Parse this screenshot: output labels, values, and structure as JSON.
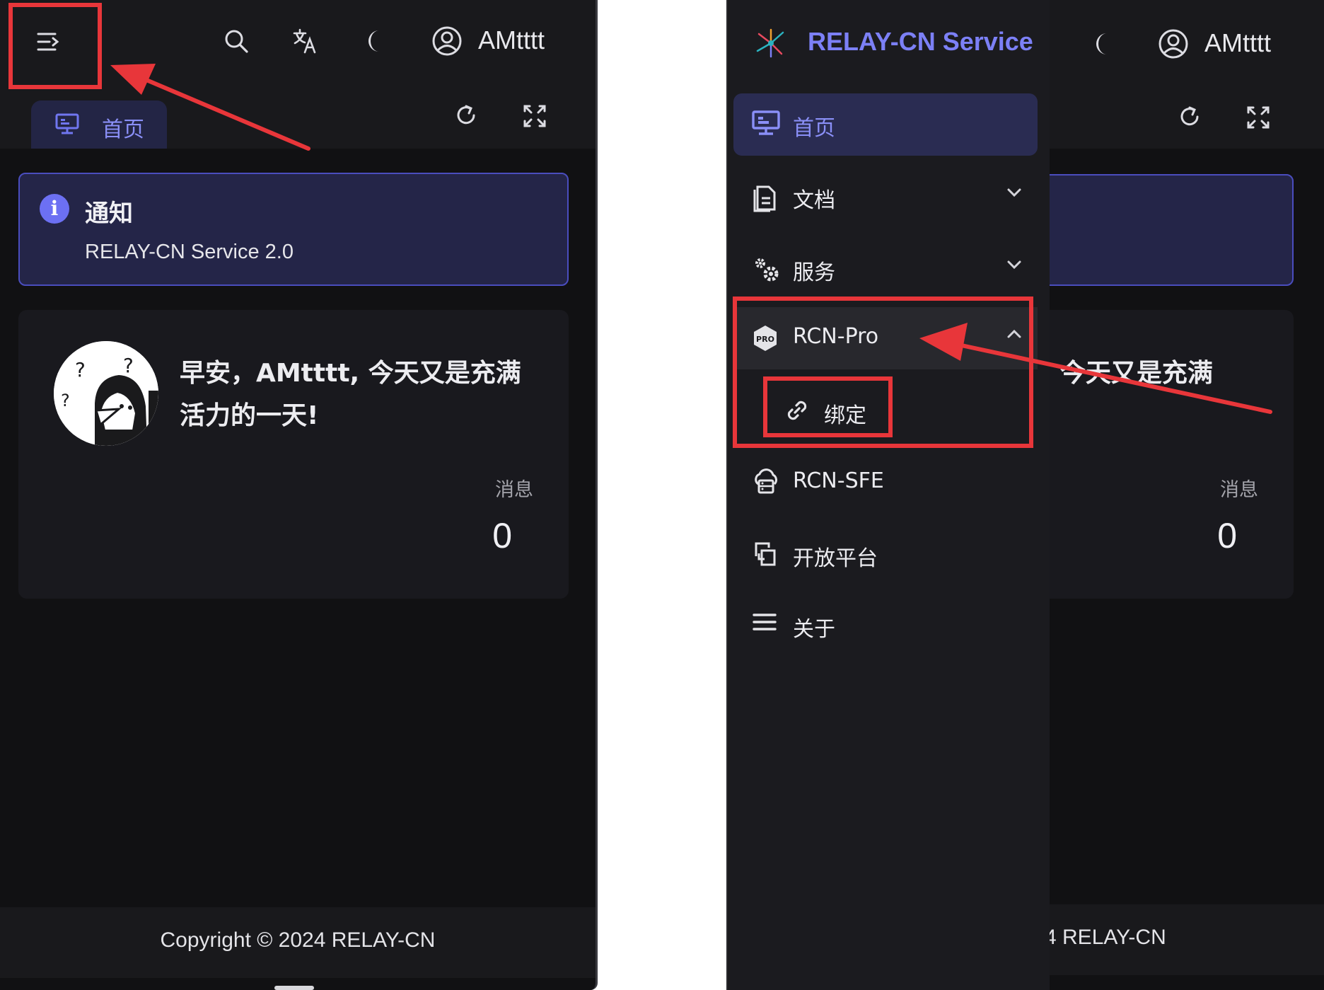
{
  "user": {
    "name": "AMtttt"
  },
  "tabs": {
    "home_label": "首页"
  },
  "notice": {
    "title": "通知",
    "message": "RELAY-CN Service 2.0",
    "icon": "info-icon",
    "accent": "#6c70f3"
  },
  "welcome": {
    "greeting_line1": "早安，AMtttt, 今天又是充满",
    "greeting_line2": "活力的一天!",
    "greeting_partial": "ttt, 今天又是充满",
    "messages_label": "消息",
    "messages_count": "0"
  },
  "footer": {
    "copyright": "Copyright © 2024 RELAY-CN",
    "copyright_partial": "4 RELAY-CN"
  },
  "sidebar": {
    "brand": "RELAY-CN Service",
    "items": [
      {
        "label": "首页",
        "icon": "monitor-icon",
        "active": true
      },
      {
        "label": "文档",
        "icon": "document-icon",
        "expandable": true
      },
      {
        "label": "服务",
        "icon": "gears-icon",
        "expandable": true
      },
      {
        "label": "RCN-Pro",
        "icon": "pro-badge-icon",
        "expandable": true,
        "expanded": true,
        "children": [
          {
            "label": "绑定",
            "icon": "link-icon"
          }
        ]
      },
      {
        "label": "RCN-SFE",
        "icon": "cloud-server-icon"
      },
      {
        "label": "开放平台",
        "icon": "platform-icon"
      },
      {
        "label": "关于",
        "icon": "hamburger-icon"
      }
    ]
  },
  "colors": {
    "background": "#111113",
    "surface": "#19191c",
    "accent": "#7c80f6",
    "highlight": "#e8363a"
  }
}
